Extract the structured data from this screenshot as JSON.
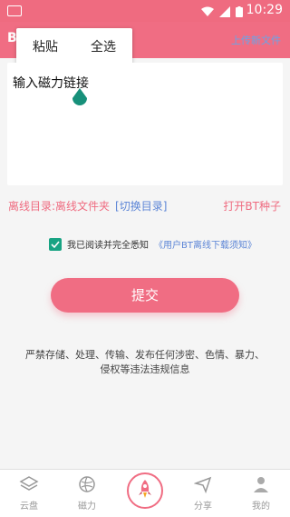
{
  "statusbar": {
    "time": "10:29"
  },
  "appbar": {
    "title": "BT",
    "right_link": "上传新文件"
  },
  "popup": {
    "paste": "粘贴",
    "select_all": "全选"
  },
  "input": {
    "placeholder": "输入磁力链接"
  },
  "offline": {
    "dir_label": "离线目录:离线文件夹",
    "switch_dir": "[切换目录]",
    "open_bt": "打开BT种子"
  },
  "agreement": {
    "prefix": "我已阅读并完全悉知",
    "link": "《用户BT离线下载须知》"
  },
  "submit_label": "提交",
  "notice": "严禁存储、处理、传输、发布任何涉密、色情、暴力、侵权等违法违规信息",
  "tabs": [
    {
      "label": "云盘",
      "icon": "layers-icon"
    },
    {
      "label": "磁力",
      "icon": "globe-icon"
    },
    {
      "label": "",
      "icon": "rocket-icon"
    },
    {
      "label": "分享",
      "icon": "paper-plane-icon"
    },
    {
      "label": "我的",
      "icon": "person-icon"
    }
  ],
  "colors": {
    "accent": "#f06d83",
    "link": "#5c85d6",
    "check": "#18a383"
  }
}
